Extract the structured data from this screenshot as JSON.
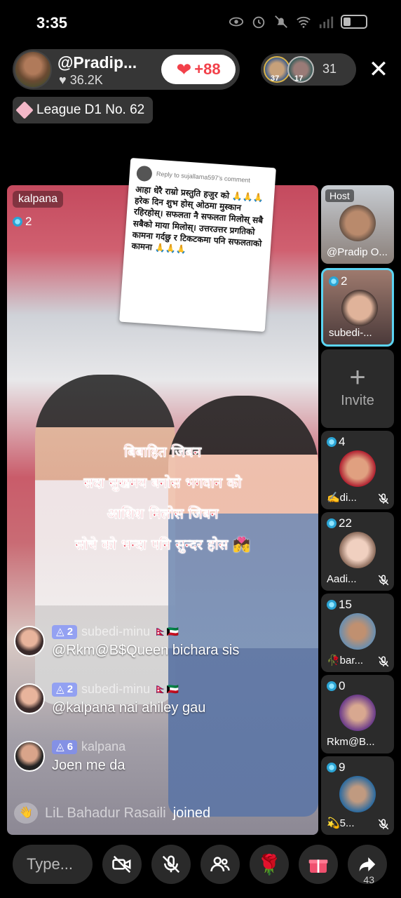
{
  "status_bar": {
    "time": "3:35",
    "icons": [
      "payment-icon",
      "eye-icon",
      "alarm-icon",
      "mute-icon",
      "wifi-icon",
      "signal-icon",
      "battery-icon"
    ]
  },
  "host": {
    "name": "@Pradip...",
    "likes": "♥ 36.2K",
    "like_button_count": "+88"
  },
  "viewers": {
    "top1_level": "37",
    "top2_level": "17",
    "count": "31"
  },
  "league": {
    "label": "League D1 No. 62"
  },
  "main_video": {
    "name": "kalpana",
    "count": "2",
    "reply_card": {
      "label": "Reply to sujallama597's comment",
      "text": "आहा धेरै राम्रो प्रस्तुति हजुर को 🙏🙏🙏 हरेक दिन शुभ होस् ओठमा मुस्कान रहिरहोस्। सफलता नै सफलता मिलोस् सबै सबैको माया मिलोस्। उत्तरउत्तर प्रगतिको कामना गर्दछु र टिकटकमा पनि सफलताको कामना 🙏🙏🙏"
    },
    "overlay_lines": [
      "बिबाहित जिबन",
      "सदा सुखमय बनोस भगवान को",
      "आशिश मिलोस जिबन",
      "सोचे को भन्दा पनि सुन्दर होस 💏"
    ]
  },
  "comments": [
    {
      "level": "2",
      "user": "subedi-minu",
      "flags": "🇳🇵🇰🇼",
      "text": "@Rkm@B$Queen bichara sis"
    },
    {
      "level": "2",
      "user": "subedi-minu",
      "flags": "🇳🇵🇰🇼",
      "text": "@kalpana nai ahiley gau"
    },
    {
      "level": "6",
      "user": "kalpana",
      "flags": "",
      "text": "Joen me da"
    }
  ],
  "join": {
    "user": "LiL  Bahadur  Rasaili",
    "text": "joined"
  },
  "guests": [
    {
      "badge": "Host",
      "name": "@Pradip O..."
    },
    {
      "count": "2",
      "name": "subedi-..."
    },
    {
      "invite": "Invite"
    },
    {
      "count": "4",
      "name": "✍️di..."
    },
    {
      "count": "22",
      "name": "Aadi..."
    },
    {
      "count": "15",
      "name": "🥀bar..."
    },
    {
      "count": "0",
      "name": "Rkm@B..."
    },
    {
      "count": "9",
      "name": "💫5..."
    }
  ],
  "bottom_bar": {
    "input_placeholder": "Type...",
    "share_count": "43"
  },
  "colors": {
    "accent_red": "#f2404a",
    "active_border": "#5bd4f2",
    "overlay_text": "#e8243c"
  }
}
